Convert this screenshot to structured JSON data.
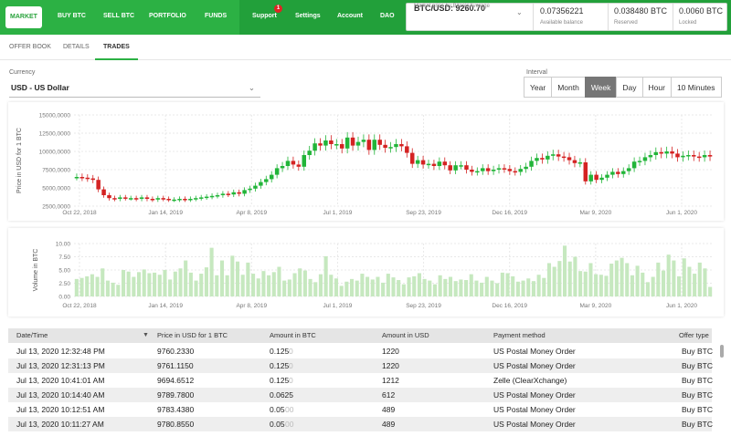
{
  "nav": {
    "items": [
      "MARKET",
      "BUY BTC",
      "SELL BTC",
      "PORTFOLIO",
      "FUNDS",
      "Support",
      "Settings",
      "Account",
      "DAO"
    ],
    "support_badge": "1"
  },
  "info": {
    "price": "BTC/USD: 9260.70",
    "price_sub": "Market price by BitcoinAverage",
    "available": "0.07356221",
    "available_label": "Available balance",
    "reserved": "0.038480 BTC",
    "reserved_label": "Reserved",
    "locked": "0.0060 BTC",
    "locked_label": "Locked"
  },
  "tabs": [
    "OFFER BOOK",
    "DETAILS",
    "TRADES"
  ],
  "currency": {
    "label": "Currency",
    "value": "USD  -  US Dollar"
  },
  "interval": {
    "label": "Interval",
    "options": [
      "Year",
      "Month",
      "Week",
      "Day",
      "Hour",
      "10 Minutes"
    ],
    "selected": "Week"
  },
  "colors": {
    "accent": "#2cb144",
    "nav_bg": "#22a03a",
    "up": "#22b539",
    "down": "#d42222",
    "volume": "#c6e8bf"
  },
  "table": {
    "headers": [
      "Date/Time",
      "Price in USD for 1 BTC",
      "Amount in BTC",
      "Amount in USD",
      "Payment method",
      "Offer type"
    ],
    "sort_indicator": "▼",
    "rows": [
      {
        "date": "Jul 13, 2020 12:32:48 PM",
        "price": "9760.2330",
        "amount": "0.125",
        "amount_pad": "0",
        "usd": "1220",
        "method": "US Postal Money Order",
        "type": "Buy BTC"
      },
      {
        "date": "Jul 13, 2020 12:31:13 PM",
        "price": "9761.1150",
        "amount": "0.125",
        "amount_pad": "0",
        "usd": "1220",
        "method": "US Postal Money Order",
        "type": "Buy BTC"
      },
      {
        "date": "Jul 13, 2020 10:41:01 AM",
        "price": "9694.6512",
        "amount": "0.125",
        "amount_pad": "0",
        "usd": "1212",
        "method": "Zelle (ClearXchange)",
        "type": "Buy BTC"
      },
      {
        "date": "Jul 13, 2020 10:14:40 AM",
        "price": "9789.7800",
        "amount": "0.0625",
        "amount_pad": "",
        "usd": "612",
        "method": "US Postal Money Order",
        "type": "Buy BTC"
      },
      {
        "date": "Jul 13, 2020 10:12:51 AM",
        "price": "9783.4380",
        "amount": "0.05",
        "amount_pad": "00",
        "usd": "489",
        "method": "US Postal Money Order",
        "type": "Buy BTC"
      },
      {
        "date": "Jul 13, 2020 10:11:27 AM",
        "price": "9780.8550",
        "amount": "0.05",
        "amount_pad": "00",
        "usd": "489",
        "method": "US Postal Money Order",
        "type": "Buy BTC"
      }
    ]
  },
  "chart_data": [
    {
      "type": "candlestick",
      "ylabel": "Price in USD for 1 BTC",
      "ylim": [
        2500,
        15000
      ],
      "y_ticks": [
        "15000,0000",
        "12500,0000",
        "10000,0000",
        "7500,0000",
        "5000,0000",
        "2500,0000"
      ],
      "x_ticks": [
        "Oct 22, 2018",
        "Jan 14, 2019",
        "Apr 8, 2019",
        "Jul 1, 2019",
        "Sep 23, 2019",
        "Dec 16, 2019",
        "Mar 9, 2020",
        "Jun 1, 2020"
      ],
      "grid": true,
      "close": [
        6500,
        6400,
        6300,
        6100,
        4800,
        4000,
        3600,
        3500,
        3700,
        3600,
        3600,
        3500,
        3700,
        3500,
        3400,
        3600,
        3500,
        3400,
        3400,
        3500,
        3400,
        3500,
        3600,
        3700,
        3800,
        3900,
        4000,
        4200,
        4100,
        4400,
        4200,
        4700,
        4900,
        5300,
        5800,
        6200,
        6800,
        7700,
        8000,
        8700,
        8200,
        7900,
        9500,
        10100,
        11100,
        10800,
        11500,
        11000,
        11000,
        10400,
        11900,
        10800,
        11300,
        11600,
        10200,
        11600,
        10900,
        10500,
        10600,
        11000,
        10700,
        9800,
        8300,
        8800,
        8200,
        8300,
        8000,
        8600,
        8100,
        7400,
        8100,
        8100,
        7500,
        7200,
        7300,
        7700,
        7300,
        7500,
        7700,
        7600,
        7300,
        7200,
        7600,
        7900,
        8700,
        9100,
        8900,
        9400,
        9600,
        9300,
        9200,
        8800,
        8400,
        8500,
        5900,
        6800,
        6100,
        6400,
        6800,
        7200,
        6900,
        7300,
        7700,
        8600,
        8700,
        9200,
        9500,
        9900,
        9700,
        10000,
        9700,
        9200,
        9400,
        9500,
        9300,
        9200,
        9500,
        9300
      ],
      "volume_chart": {
        "ylabel": "Volume in BTC",
        "ylim": [
          0,
          10
        ],
        "y_ticks": [
          "10.00",
          "7.50",
          "5.00",
          "2.50",
          "0.00"
        ],
        "values": [
          3.3,
          3.5,
          3.8,
          4.2,
          3.7,
          5.3,
          3.0,
          2.6,
          2.2,
          5.0,
          4.7,
          3.7,
          4.6,
          5.1,
          4.4,
          4.5,
          4.1,
          5.0,
          3.2,
          4.7,
          5.3,
          6.8,
          4.5,
          3.0,
          4.3,
          5.5,
          9.2,
          4.0,
          6.8,
          4.0,
          7.7,
          6.6,
          4.1,
          6.4,
          4.3,
          3.4,
          4.8,
          4.0,
          4.6,
          5.6,
          3.0,
          3.2,
          4.4,
          5.3,
          4.9,
          3.3,
          2.7,
          4.2,
          7.6,
          4.1,
          3.4,
          2.0,
          2.8,
          3.3,
          3.0,
          4.3,
          3.7,
          3.2,
          3.7,
          2.6,
          4.3,
          3.6,
          3.1,
          2.3,
          3.6,
          3.8,
          4.4,
          3.3,
          3.0,
          2.3,
          4.0,
          3.3,
          3.7,
          2.9,
          3.2,
          3.1,
          4.2,
          3.0,
          2.6,
          3.7,
          3.0,
          2.5,
          4.5,
          4.4,
          3.8,
          2.8,
          3.0,
          3.4,
          2.9,
          4.1,
          3.5,
          6.3,
          5.6,
          6.7,
          9.6,
          6.6,
          7.5,
          4.8,
          4.7,
          6.3,
          4.2,
          4.1,
          3.9,
          6.2,
          6.8,
          7.3,
          6.3,
          4.0,
          5.8,
          4.5,
          2.7,
          3.7,
          6.4,
          4.9,
          7.9,
          6.8,
          3.8,
          7.2,
          5.6,
          4.3,
          6.4,
          5.3,
          1.8
        ]
      }
    }
  ]
}
